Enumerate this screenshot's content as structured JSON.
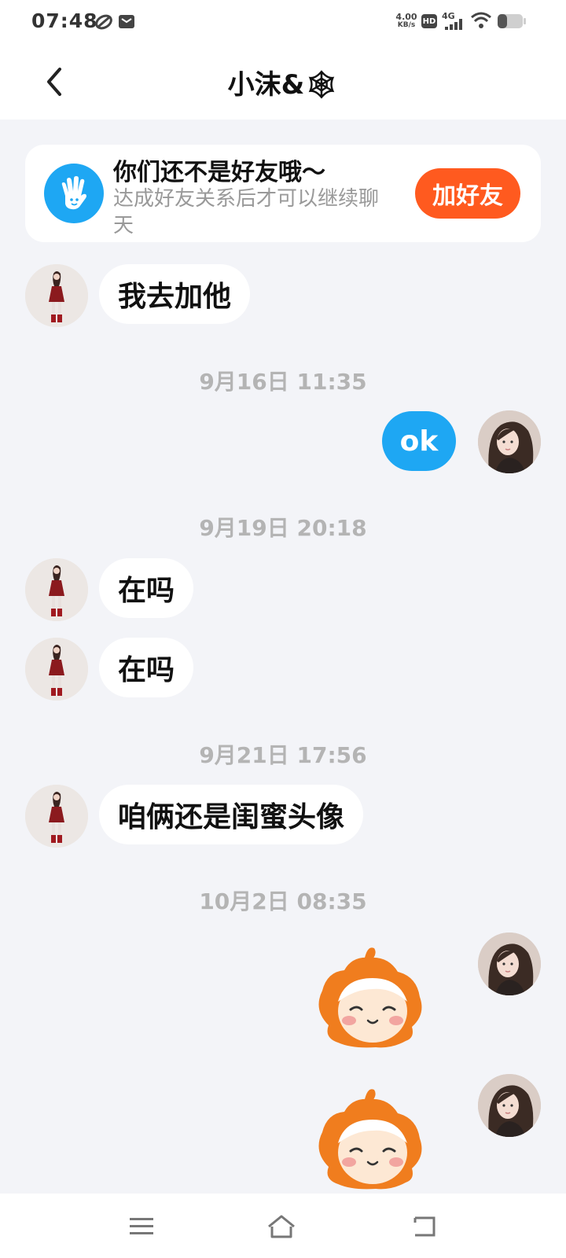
{
  "status_bar": {
    "time": "07:48",
    "net_speed_value": "4.00",
    "net_speed_unit": "KB/s",
    "hd": "HD",
    "network": "4G",
    "icons": [
      "sync-icon",
      "mail-icon",
      "signal-icon",
      "wifi-icon",
      "battery-icon"
    ]
  },
  "header": {
    "title": "小沫&🕸"
  },
  "friend_banner": {
    "title": "你们还不是好友哦～",
    "subtitle": "达成好友关系后才可以继续聊天",
    "button_label": "加好友",
    "accent": "#ff5a1f"
  },
  "messages": [
    {
      "side": "left",
      "text": "我去加他"
    },
    {
      "type": "time",
      "text": "9月16日 11:35"
    },
    {
      "side": "right",
      "text": "ok"
    },
    {
      "type": "time",
      "text": "9月19日 20:18"
    },
    {
      "side": "left",
      "text": "在吗"
    },
    {
      "side": "left",
      "text": "在吗"
    },
    {
      "type": "time",
      "text": "9月21日 17:56"
    },
    {
      "side": "left",
      "text": "咱俩还是闺蜜头像"
    },
    {
      "type": "time",
      "text": "10月2日 08:35"
    },
    {
      "side": "right",
      "type": "sticker",
      "sticker": "orange-hair-smile-sticker"
    },
    {
      "side": "right",
      "type": "sticker",
      "sticker": "orange-hair-smile-sticker"
    }
  ],
  "colors": {
    "chat_background": "#f3f4f8",
    "my_bubble": "#1ea7f3",
    "their_bubble": "#ffffff",
    "timestamp": "#b4b4b4"
  },
  "bottom_nav": {
    "icons": [
      "menu-icon",
      "home-icon",
      "back-icon"
    ]
  }
}
